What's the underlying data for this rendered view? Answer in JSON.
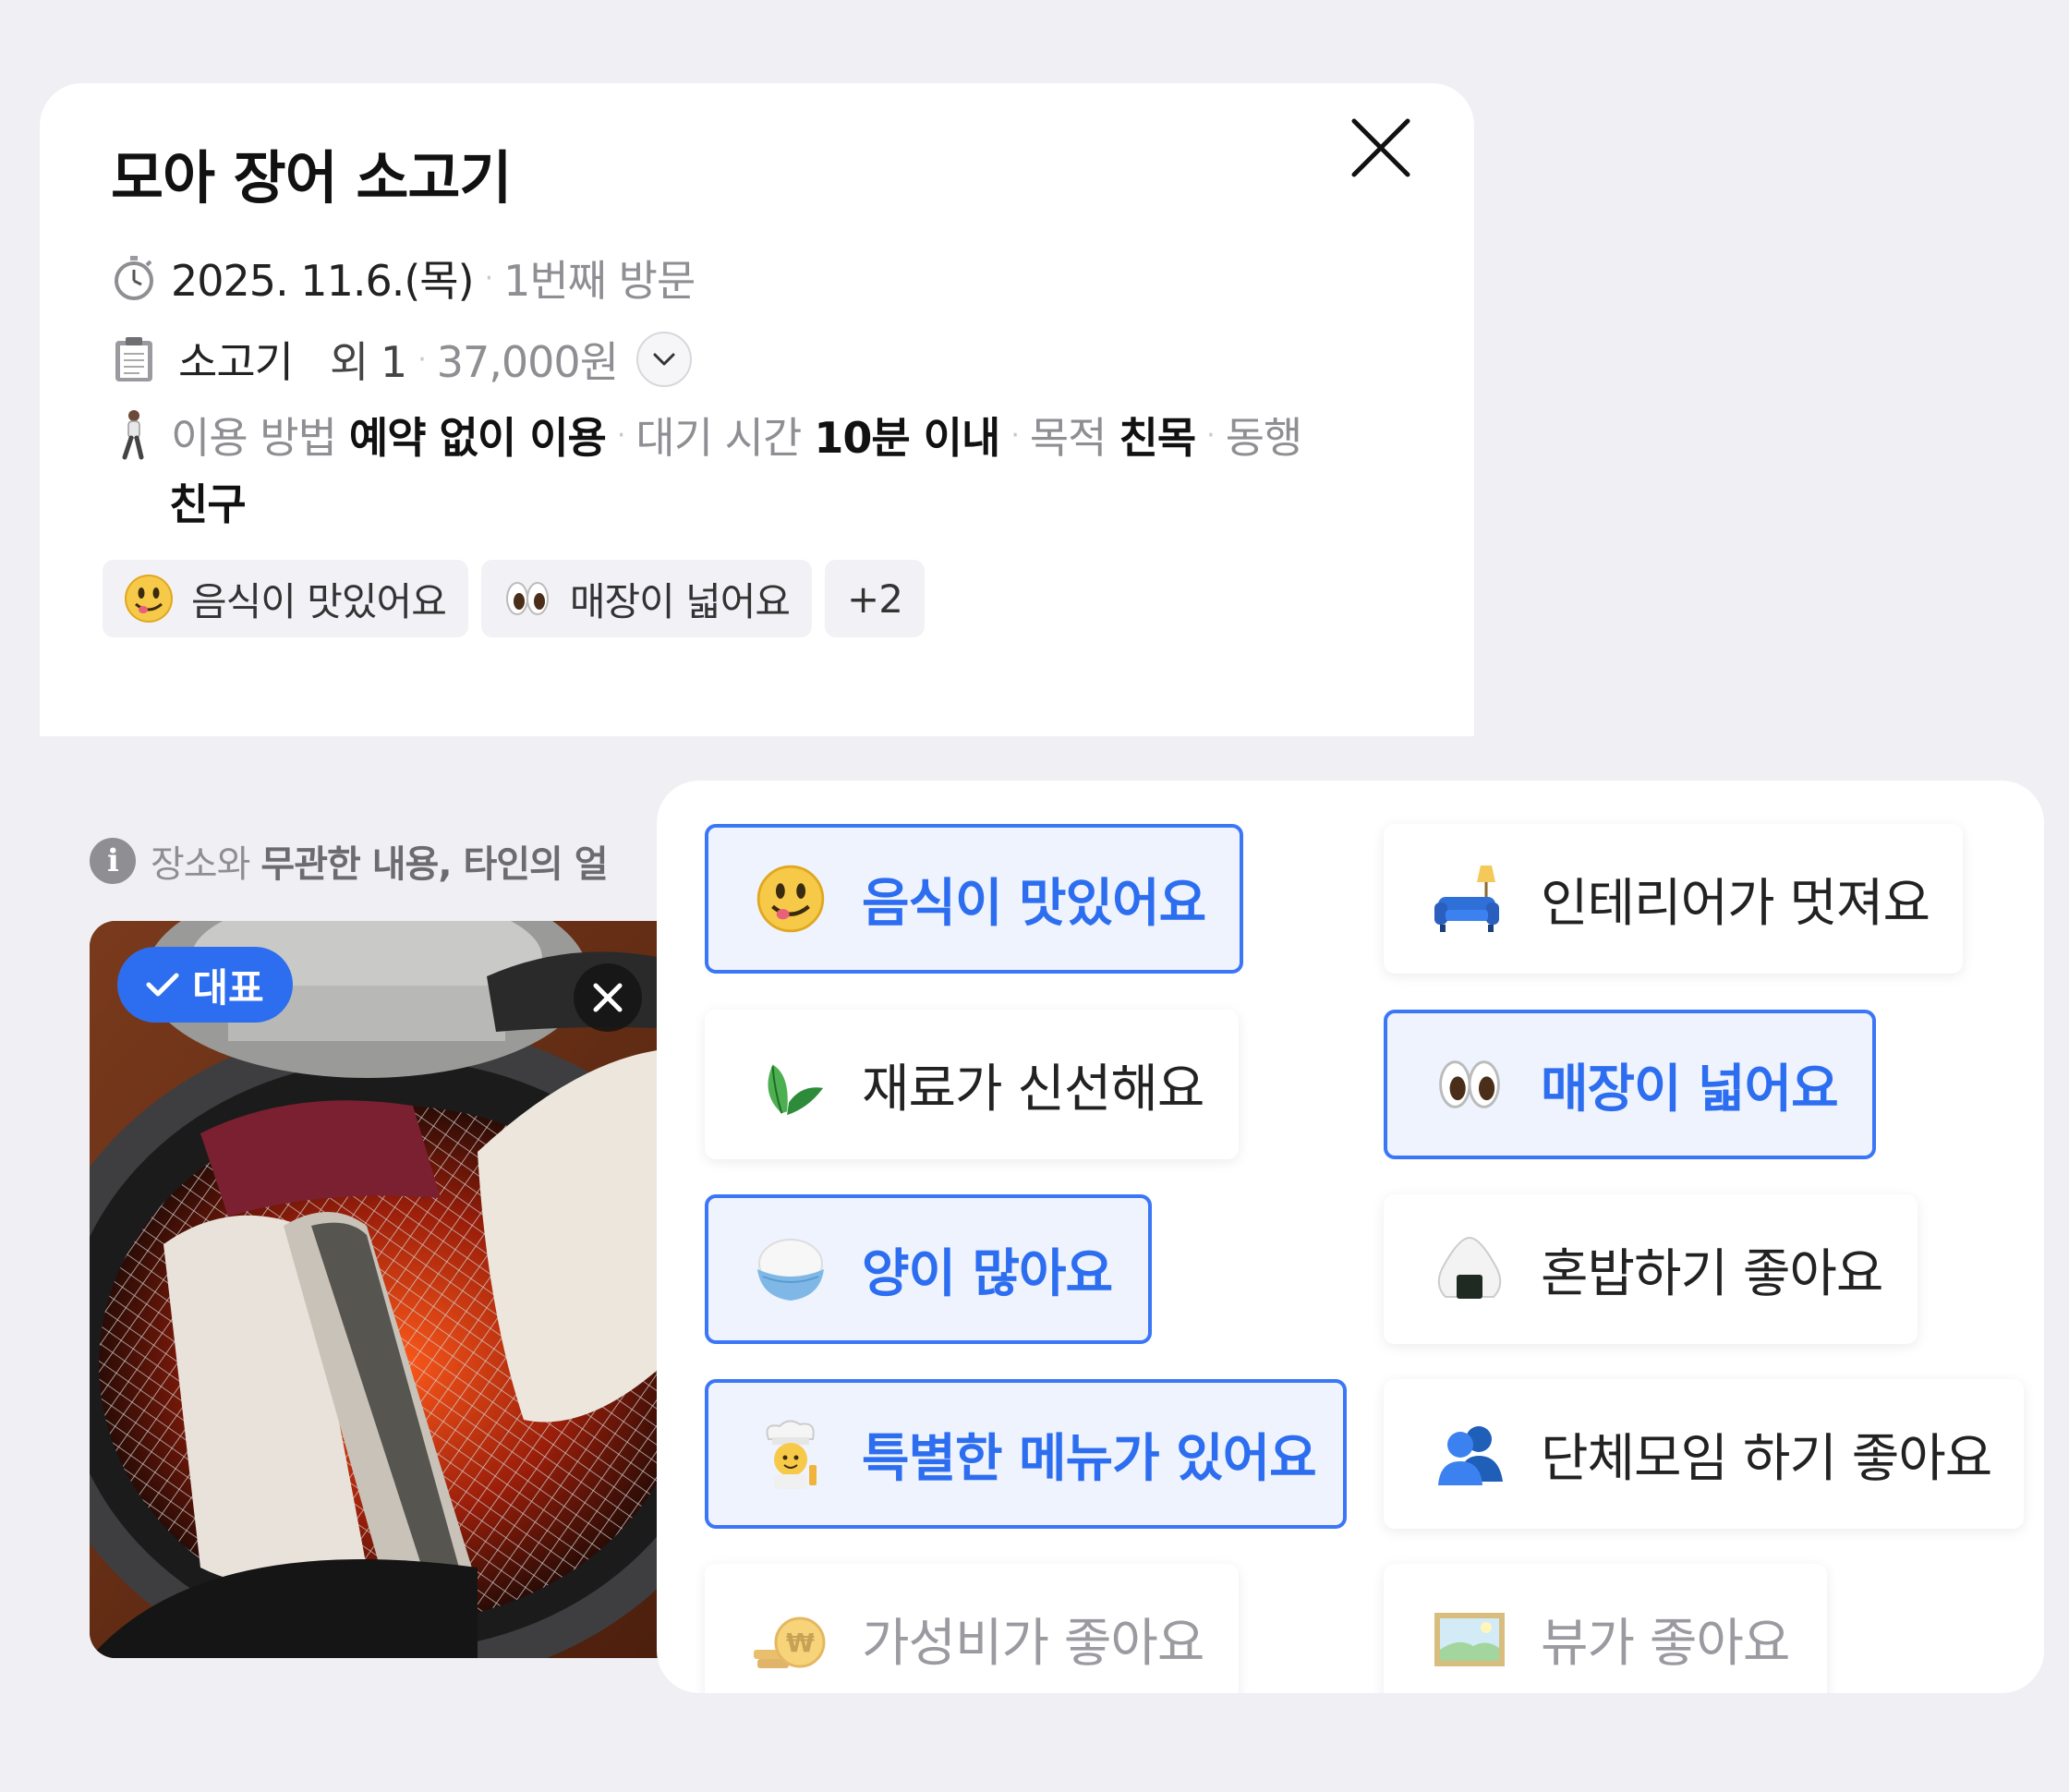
{
  "review": {
    "place_name": "모아 장어 소고기",
    "visit_date": "2025. 11.6.(목)",
    "visit_count": "1번째 방문",
    "menu": "소고기",
    "menu_extra": "외 1",
    "price": "37,000원",
    "usage_label": "이용 방법",
    "usage_value": "예약 없이 이용",
    "wait_label": "대기 시간",
    "wait_value": "10분 이내",
    "purpose_label": "목적",
    "purpose_value": "친목",
    "companion_label": "동행",
    "companion_value": "친구",
    "chips": [
      {
        "icon": "yum-face-icon",
        "label": "음식이 맛있어요"
      },
      {
        "icon": "eyes-icon",
        "label": "매장이 넓어요"
      }
    ],
    "more_chip": "+2"
  },
  "photo_section": {
    "notice_prefix": "장소와",
    "notice_bold": "무관한 내용, 타인의 얼",
    "rep_badge": "대표"
  },
  "keywords": [
    {
      "icon": "yum-face-icon",
      "label": "음식이 맛있어요",
      "selected": true
    },
    {
      "icon": "sofa-lamp-icon",
      "label": "인테리어가 멋져요",
      "selected": false
    },
    {
      "icon": "leaf-icon",
      "label": "재료가 신선해요",
      "selected": false
    },
    {
      "icon": "eyes-icon",
      "label": "매장이 넓어요",
      "selected": true
    },
    {
      "icon": "rice-bowl-icon",
      "label": "양이 많아요",
      "selected": true
    },
    {
      "icon": "onigiri-icon",
      "label": "혼밥하기 좋아요",
      "selected": false
    },
    {
      "icon": "chef-icon",
      "label": "특별한 메뉴가 있어요",
      "selected": true
    },
    {
      "icon": "group-people-icon",
      "label": "단체모임 하기 좋아요",
      "selected": false
    },
    {
      "icon": "coin-icon",
      "label": "가성비가 좋아요",
      "selected": false
    },
    {
      "icon": "landscape-picture-icon",
      "label": "뷰가 좋아요",
      "selected": false
    }
  ],
  "colors": {
    "accent": "#2d6ef0",
    "selected_bg": "#eef3fe",
    "page_bg": "#efeff4"
  }
}
